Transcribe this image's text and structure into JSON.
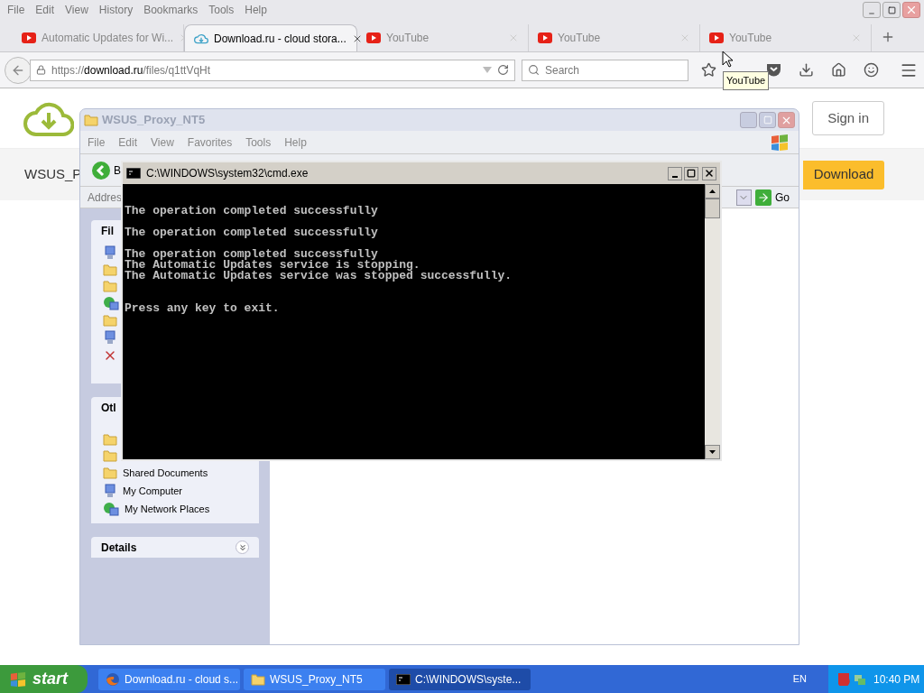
{
  "browser": {
    "menu": [
      "File",
      "Edit",
      "View",
      "History",
      "Bookmarks",
      "Tools",
      "Help"
    ],
    "tabs": [
      {
        "title": "Automatic Updates for Wi...",
        "kind": "video",
        "selected": false
      },
      {
        "title": "Download.ru - cloud stora...",
        "kind": "cloud",
        "selected": true
      },
      {
        "title": "YouTube",
        "kind": "video",
        "selected": false
      },
      {
        "title": "YouTube",
        "kind": "video",
        "selected": false
      },
      {
        "title": "YouTube",
        "kind": "video",
        "selected": false
      }
    ],
    "url": {
      "scheme": "https://",
      "domain": "download.ru",
      "path": "/files/q1ttVqHt"
    },
    "search": {
      "placeholder": "Search"
    },
    "tooltip": "YouTube"
  },
  "page": {
    "file_title": "WSUS_P",
    "sign_in": "Sign in",
    "download": "Download"
  },
  "explorer": {
    "title": "WSUS_Proxy_NT5",
    "menu": [
      "File",
      "Edit",
      "View",
      "Favorites",
      "Tools",
      "Help"
    ],
    "back_label": "B",
    "address_label": "Addres",
    "go": "Go",
    "file_tasks": {
      "title": "Fil"
    },
    "other_places": {
      "title": "Otl",
      "items": [
        {
          "label": "Shared Documents",
          "kind": "folder"
        },
        {
          "label": "My Computer",
          "kind": "computer"
        },
        {
          "label": "My Network Places",
          "kind": "network"
        }
      ]
    },
    "details": {
      "title": "Details",
      "expanded": false
    }
  },
  "cmd": {
    "title": "C:\\WINDOWS\\system32\\cmd.exe",
    "blocks": [
      [
        "The operation completed successfully"
      ],
      [
        "The operation completed successfully"
      ],
      [
        "The operation completed successfully",
        "The Automatic Updates service is stopping.",
        "The Automatic Updates service was stopped successfully."
      ],
      [
        "Press any key to exit."
      ]
    ]
  },
  "taskbar": {
    "start": "start",
    "tasks": [
      {
        "label": "Download.ru - cloud s...",
        "kind": "browser",
        "selected": false
      },
      {
        "label": "WSUS_Proxy_NT5",
        "kind": "folder",
        "selected": false
      },
      {
        "label": "C:\\WINDOWS\\syste...",
        "kind": "console",
        "selected": true
      }
    ],
    "language": "EN",
    "clock": "10:40 PM"
  }
}
